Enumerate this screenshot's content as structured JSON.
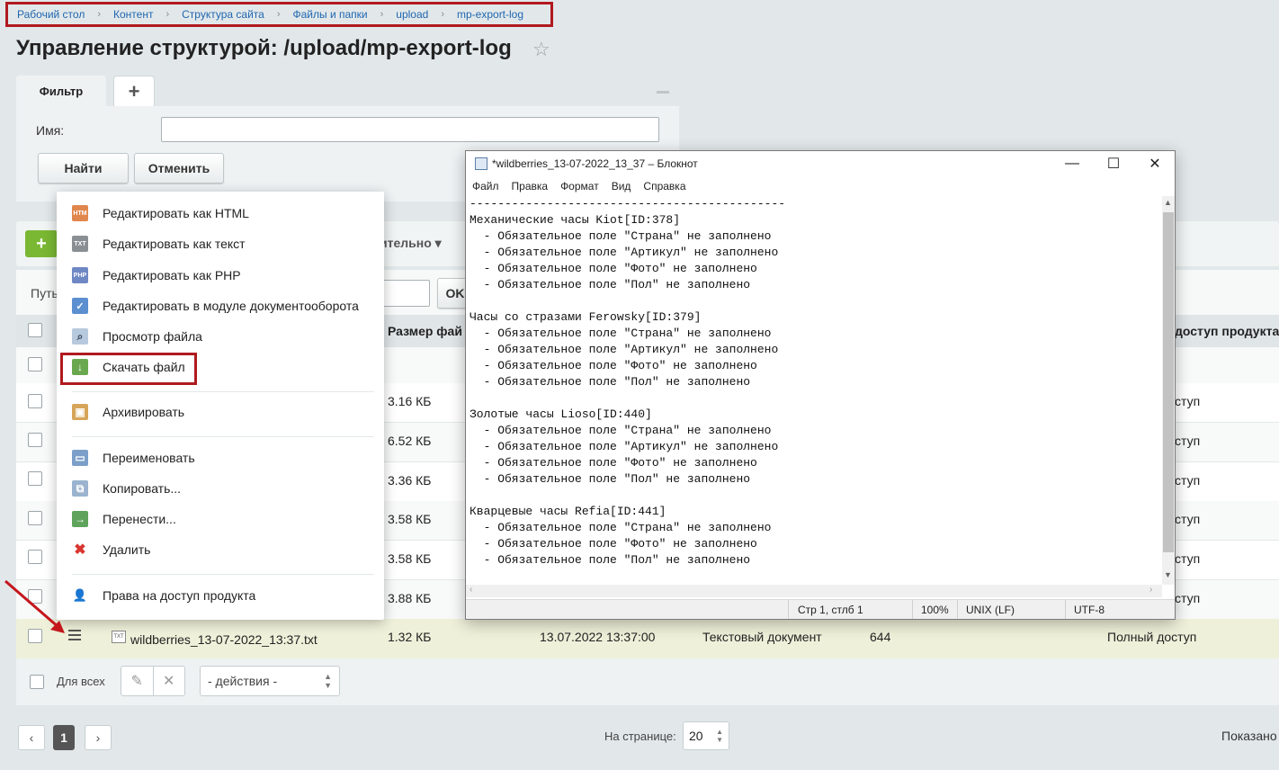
{
  "breadcrumb": [
    "Рабочий стол",
    "Контент",
    "Структура сайта",
    "Файлы и папки",
    "upload",
    "mp-export-log"
  ],
  "page_title": "Управление структурой: /upload/mp-export-log",
  "filter": {
    "tab_label": "Фильтр",
    "add_tab": "+",
    "name_label": "Имя:",
    "name_value": "",
    "find_button": "Найти",
    "cancel_button": "Отменить"
  },
  "toolbar": {
    "add": "+",
    "extra_dropdown": "ительно  ▾"
  },
  "path": {
    "label": "Путь",
    "ok": "OK"
  },
  "table": {
    "headers": {
      "size": "Размер фай",
      "access": "доступ продукта"
    },
    "rows": [
      {
        "size": "",
        "access": ""
      },
      {
        "size": "3.16 КБ",
        "access": "ступ"
      },
      {
        "size": "6.52 КБ",
        "access": "ступ"
      },
      {
        "size": "3.36 КБ",
        "access": "ступ"
      },
      {
        "size": "3.58 КБ",
        "access": "ступ"
      },
      {
        "size": "3.58 КБ",
        "access": "ступ"
      },
      {
        "size": "3.88 КБ",
        "access": "ступ"
      }
    ],
    "selected_row": {
      "name": "wildberries_13-07-2022_13:37.txt",
      "size": "1.32 КБ",
      "date": "13.07.2022 13:37:00",
      "type": "Текстовый документ",
      "perms": "644",
      "access": "Полный доступ"
    }
  },
  "footer": {
    "for_all": "Для всех",
    "actions": "- действия -"
  },
  "pagination": {
    "prev": "‹",
    "page": "1",
    "next": "›",
    "per_page_label": "На странице:",
    "per_page": "20",
    "shown": "Показано"
  },
  "context_menu": {
    "items": [
      {
        "label": "Редактировать как HTML",
        "icon": "html-file-icon",
        "icon_text": "HTM"
      },
      {
        "label": "Редактировать как текст",
        "icon": "text-file-icon",
        "icon_text": "TXT"
      },
      {
        "label": "Редактировать как PHP",
        "icon": "php-file-icon",
        "icon_text": "PHP"
      },
      {
        "label": "Редактировать в модуле документооборота",
        "icon": "workflow-icon",
        "icon_text": "✓"
      },
      {
        "label": "Просмотр файла",
        "icon": "view-file-icon",
        "icon_text": "⌕"
      },
      {
        "label": "Скачать файл",
        "icon": "download-icon",
        "icon_text": "↓"
      },
      {
        "label": "Архивировать",
        "icon": "archive-icon",
        "icon_text": "▣"
      },
      {
        "label": "Переименовать",
        "icon": "rename-icon",
        "icon_text": "▭"
      },
      {
        "label": "Копировать...",
        "icon": "copy-icon",
        "icon_text": "⧉"
      },
      {
        "label": "Перенести...",
        "icon": "move-icon",
        "icon_text": "→"
      },
      {
        "label": "Удалить",
        "icon": "delete-icon",
        "icon_text": "✖"
      },
      {
        "label": "Права на доступ продукта",
        "icon": "access-rights-icon",
        "icon_text": "👤"
      }
    ]
  },
  "notepad": {
    "title": "*wildberries_13-07-2022_13_37 – Блокнот",
    "menu": [
      "Файл",
      "Правка",
      "Формат",
      "Вид",
      "Справка"
    ],
    "content": "---------------------------------------------\nМеханические часы Kiot[ID:378]\n  - Обязательное поле \"Страна\" не заполнено\n  - Обязательное поле \"Артикул\" не заполнено\n  - Обязательное поле \"Фото\" не заполнено\n  - Обязательное поле \"Пол\" не заполнено\n\nЧасы со стразами Ferowsky[ID:379]\n  - Обязательное поле \"Страна\" не заполнено\n  - Обязательное поле \"Артикул\" не заполнено\n  - Обязательное поле \"Фото\" не заполнено\n  - Обязательное поле \"Пол\" не заполнено\n\nЗолотые часы Lioso[ID:440]\n  - Обязательное поле \"Страна\" не заполнено\n  - Обязательное поле \"Артикул\" не заполнено\n  - Обязательное поле \"Фото\" не заполнено\n  - Обязательное поле \"Пол\" не заполнено\n\nКварцевые часы Refia[ID:441]\n  - Обязательное поле \"Страна\" не заполнено\n  - Обязательное поле \"Фото\" не заполнено\n  - Обязательное поле \"Пол\" не заполнено",
    "status": {
      "position": "Стр 1, стлб 1",
      "zoom": "100%",
      "eol": "UNIX (LF)",
      "encoding": "UTF-8"
    }
  },
  "colors": {
    "highlight_border": "#b01a1f",
    "link": "#2067b0",
    "add_button": "#7ab733",
    "selected_row": "#eef0d9"
  }
}
